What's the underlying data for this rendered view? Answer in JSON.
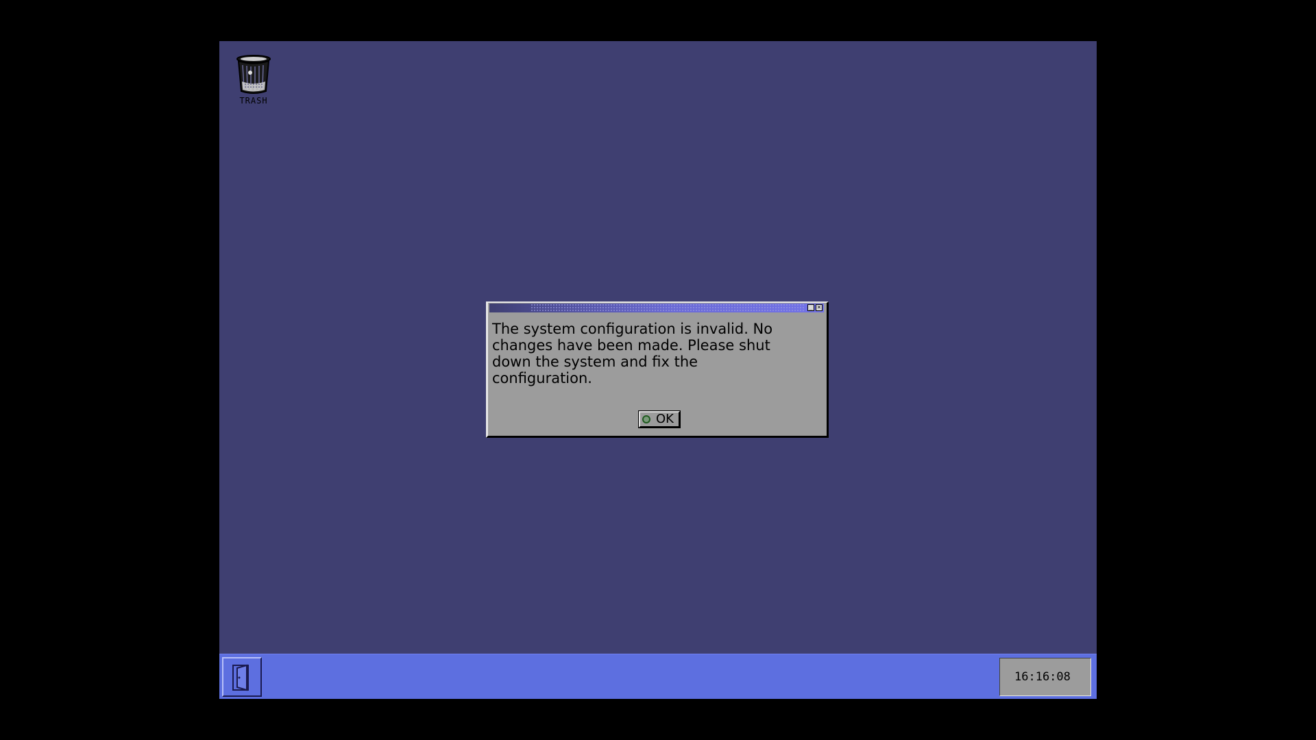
{
  "desktop": {
    "background_color": "#3f3f71",
    "icons": [
      {
        "label": "TRASH",
        "icon": "trash-can-icon"
      }
    ]
  },
  "dialog": {
    "title": "",
    "message": "The system configuration is invalid. No\nchanges have been made. Please shut\ndown the system and fix the\nconfiguration.",
    "ok_label": "OK",
    "minimize_glyph": "_",
    "close_glyph": "×"
  },
  "taskbar": {
    "color": "#5d6fe0",
    "start_icon": "door-icon",
    "clock": "16:16:08"
  }
}
